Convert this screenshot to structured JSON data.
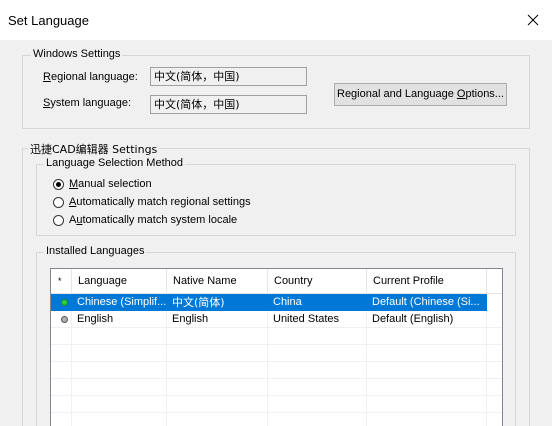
{
  "window": {
    "title": "Set Language",
    "close_glyph": "✕"
  },
  "windows_settings": {
    "group_label": "Windows Settings",
    "regional_label_pre": "",
    "regional_label_accel": "R",
    "regional_label_post": "egional language:",
    "regional_value": "中文(简体，中国)",
    "system_label_pre": "",
    "system_label_accel": "S",
    "system_label_post": "ystem language:",
    "system_value": "中文(简体，中国)",
    "options_button_pre": "Regional and Language ",
    "options_button_accel": "O",
    "options_button_post": "ptions..."
  },
  "app_settings": {
    "group_label": "迅捷CAD编辑器 Settings",
    "selection_group_label": "Language Selection Method",
    "radios": [
      {
        "pre": "",
        "accel": "M",
        "post": "anual selection",
        "checked": true
      },
      {
        "pre": "",
        "accel": "A",
        "post": "utomatically match regional settings",
        "checked": false
      },
      {
        "pre": "A",
        "accel": "u",
        "post": "tomatically match system locale",
        "checked": false
      }
    ]
  },
  "installed_languages": {
    "group_label": "Installed Languages",
    "columns": [
      "*",
      "Language",
      "Native Name",
      "Country",
      "Current Profile"
    ],
    "rows": [
      {
        "status_color": "#2ecc40",
        "language": "Chinese (Simplif...",
        "native": "中文(简体)",
        "country": "China",
        "profile": "Default (Chinese (Si..."
      },
      {
        "status_color": "#888888",
        "language": "English",
        "native": "English",
        "country": "United States",
        "profile": "Default (English)"
      }
    ]
  },
  "colors": {
    "selection": "#0078d7",
    "active_dot": "#2ecc40",
    "inactive_dot": "#888888"
  }
}
